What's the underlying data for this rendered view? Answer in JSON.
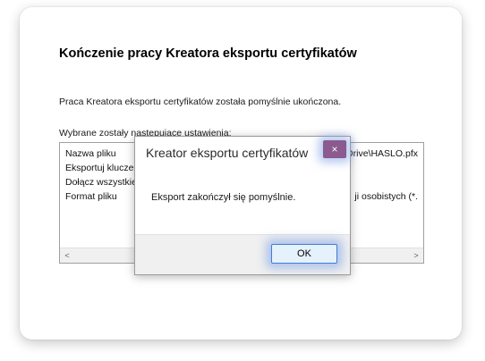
{
  "wizard": {
    "title": "Kończenie pracy Kreatora eksportu certyfikatów",
    "message": "Praca Kreatora eksportu certyfikatów została pomyślnie ukończona.",
    "settings_label": "Wybrane zostały następujące ustawienia:",
    "settings": [
      {
        "key": "Nazwa pliku",
        "value": "Drive\\HASLO.pfx"
      },
      {
        "key": "Eksportuj klucze",
        "value": ""
      },
      {
        "key": "Dołącz wszystkie",
        "value": ""
      },
      {
        "key": "Format pliku",
        "value": "ji osobistych (*."
      }
    ],
    "scroll_left": "<",
    "scroll_right": ">"
  },
  "dialog": {
    "title": "Kreator eksportu certyfikatów",
    "close_glyph": "×",
    "message": "Eksport zakończył się pomyślnie.",
    "ok_label": "OK"
  },
  "colors": {
    "close_button": "#8b5a8f",
    "ok_border": "#3c7fd6",
    "highlight_glow": "#789be6"
  }
}
